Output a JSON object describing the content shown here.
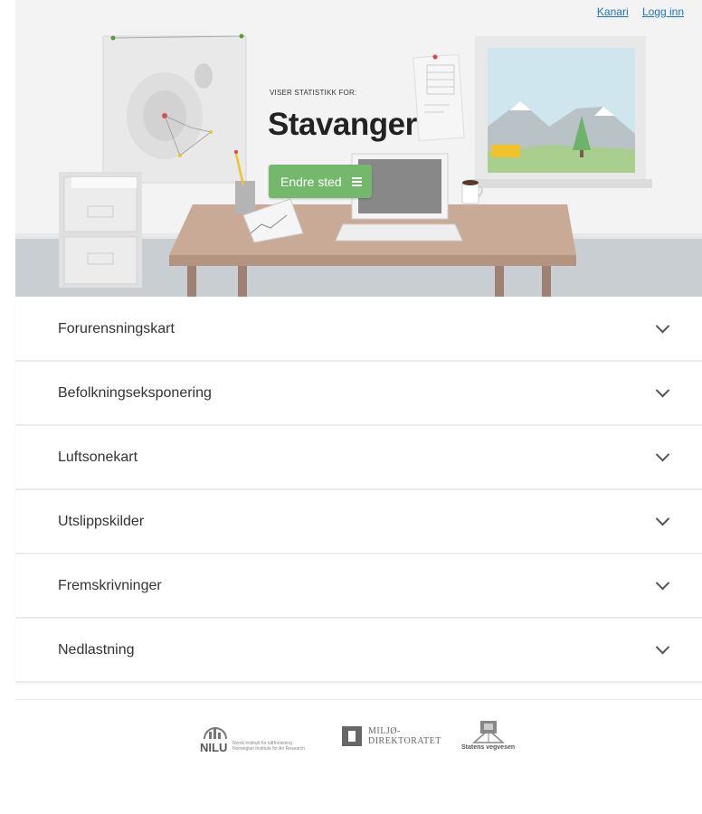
{
  "header_links": {
    "kanari": "Kanari",
    "login": "Logg inn"
  },
  "hero": {
    "caption": "VISER STATISTIKK FOR:",
    "place": "Stavanger",
    "change_button": "Endre sted"
  },
  "sections": [
    {
      "label": "Forurensningskart"
    },
    {
      "label": "Befolkningseksponering"
    },
    {
      "label": "Luftsonekart"
    },
    {
      "label": "Utslippskilder"
    },
    {
      "label": "Fremskrivninger"
    },
    {
      "label": "Nedlastning"
    }
  ],
  "footer": {
    "nilu": {
      "name": "NILU",
      "tagline_no": "Norsk institutt for luftforskning",
      "tagline_en": "Norwegian Institute for Air Research"
    },
    "miljo": {
      "line1": "MILJØ-",
      "line2": "DIREKTORATET"
    },
    "svv": {
      "name": "Statens vegvesen"
    }
  },
  "colors": {
    "accent_green": "#74b96b",
    "link_blue": "#1a73c9"
  }
}
